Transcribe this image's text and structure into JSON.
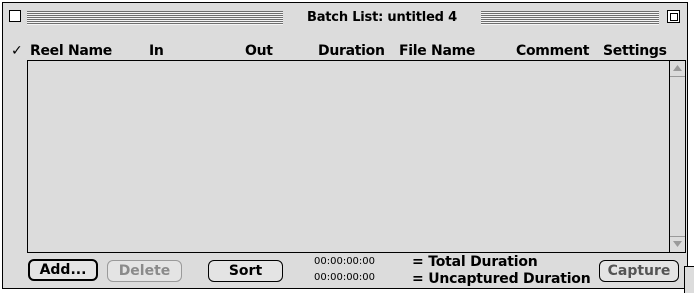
{
  "window": {
    "title": "Batch List: untitled 4"
  },
  "columns": {
    "check": "✓",
    "reel_name": "Reel Name",
    "in": "In",
    "out": "Out",
    "duration": "Duration",
    "file_name": "File Name",
    "comment": "Comment",
    "settings": "Settings"
  },
  "list": {
    "rows": []
  },
  "buttons": {
    "add": "Add...",
    "delete": "Delete",
    "sort": "Sort",
    "capture": "Capture"
  },
  "totals": {
    "total_timecode": "00:00:00:00",
    "total_label": "= Total Duration",
    "uncaptured_timecode": "00:00:00:00",
    "uncaptured_label": "= Uncaptured Duration"
  },
  "icons": {
    "close": "close-box-icon",
    "zoom": "zoom-box-icon",
    "scroll_up": "scroll-up-arrow-icon",
    "scroll_down": "scroll-down-arrow-icon",
    "grow": "grow-box-icon"
  },
  "colors": {
    "window_bg": "#dcdcdc",
    "disabled_text": "#8a8a8a"
  }
}
